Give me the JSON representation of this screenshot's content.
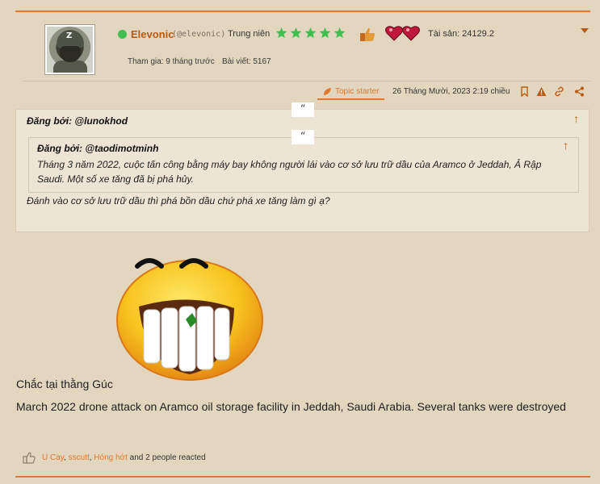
{
  "user": {
    "name": "Elevonic",
    "handle": "(@elevonic)",
    "rank": "Trung niên",
    "rating_stars": 5,
    "assets": "Tài sản: 24129.2",
    "joined": "Tham gia: 9 tháng trước",
    "posts": "Bài viết: 5167"
  },
  "post_meta": {
    "topic_starter": "Topic starter",
    "date": "26 Tháng Mười, 2023 2:19 chiều"
  },
  "quote_outer": {
    "tab": "“",
    "author": "Đăng bởi: @lunokhod",
    "reply": "Đánh vào cơ sở lưu trữ dầu thì phá bồn dầu chứ phá xe tăng làm gì ạ?"
  },
  "quote_inner": {
    "tab": "“",
    "author": "Đăng bởi: @taodimotminh",
    "text_line1": "Tháng 3 năm 2022, cuộc tấn công bằng máy bay không người lái vào cơ sở lưu trữ dầu của Aramco ở Jeddah, Ả Rập",
    "text_line2": "Saudi. Một số xe tăng đã bị phá hủy."
  },
  "body": {
    "line1": "Chắc tại thằng Gúc",
    "line2": "March 2022 drone attack on Aramco oil storage facility in Jeddah, Saudi Arabia. Several tanks were destroyed"
  },
  "reactions": {
    "user1": "U Cay",
    "sep1": ", ",
    "user2": "sscutt",
    "sep2": ", ",
    "user3": "Hóng hớt",
    "rest": " and 2 people reacted"
  },
  "icons": {
    "online": "online-status-icon",
    "star": "star-icon",
    "bookmark": "bookmark-icon",
    "report": "warning-icon",
    "link": "link-icon",
    "share": "share-icon",
    "like": "thumbs-up-icon"
  },
  "colors": {
    "background": "#e3d6bf",
    "accent": "#e0782e",
    "username": "#b85b12",
    "star": "#3fbf4f"
  }
}
